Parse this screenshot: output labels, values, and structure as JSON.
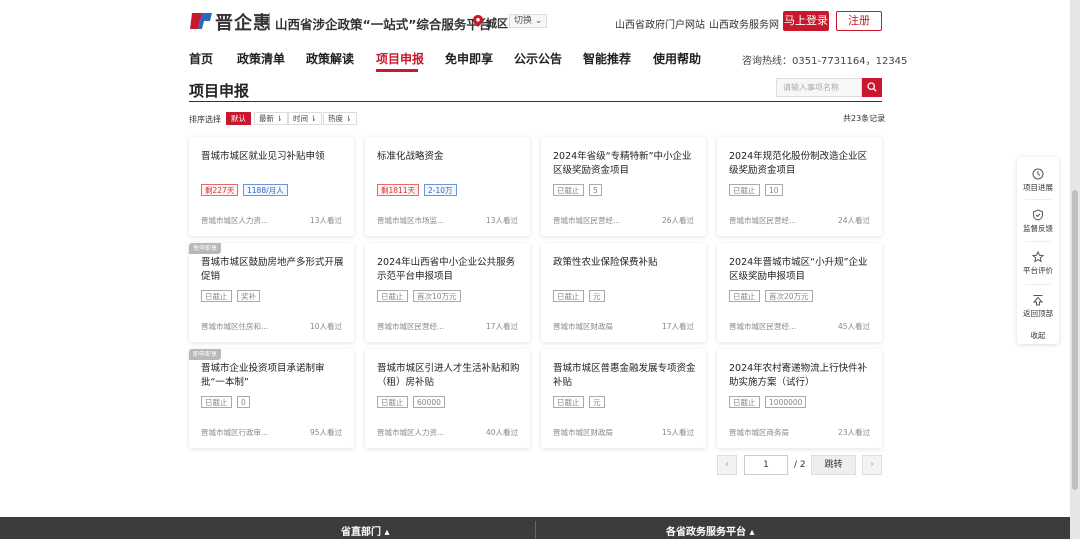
{
  "brand": {
    "logo_text": "晋企惠",
    "platform_name": "山西省涉企政策“一站式”综合服务平台",
    "location": "城区",
    "switch_label": "切换"
  },
  "top_links": [
    "山西省政府门户网站",
    "山西政务服务网"
  ],
  "auth": {
    "login": "马上登录",
    "register": "注册"
  },
  "nav": {
    "items": [
      "首页",
      "政策清单",
      "政策解读",
      "项目申报",
      "免申即享",
      "公示公告",
      "智能推荐",
      "使用帮助"
    ],
    "active": "项目申报",
    "hotline": "咨询热线：0351-7731164，12345"
  },
  "section": {
    "title": "项目申报",
    "search_placeholder": "请输入事项名称"
  },
  "sort": {
    "label": "排序选择",
    "options": [
      "默认",
      "最新 ⇂",
      "时间 ⇂",
      "热度 ⇂"
    ],
    "total": "共23条记录"
  },
  "cards": [
    {
      "name": "晋城市城区就业见习补贴申领",
      "tags": [
        {
          "t": "剩227天",
          "s": "red"
        },
        {
          "t": "1188/月人",
          "s": "blue"
        }
      ],
      "dept": "晋城市城区人力资...",
      "views": "13人看过",
      "corner": ""
    },
    {
      "name": "标准化战略资金",
      "tags": [
        {
          "t": "剩1811天",
          "s": "red"
        },
        {
          "t": "2-10万",
          "s": "blue"
        }
      ],
      "dept": "晋城市城区市场监...",
      "views": "13人看过",
      "corner": ""
    },
    {
      "name": "2024年省级“专精特新”中小企业区级奖励资金项目",
      "tags": [
        {
          "t": "已截止",
          "s": ""
        },
        {
          "t": "5",
          "s": ""
        }
      ],
      "dept": "晋城市城区民营经...",
      "views": "26人看过",
      "corner": ""
    },
    {
      "name": "2024年规范化股份制改造企业区级奖励资金项目",
      "tags": [
        {
          "t": "已截止",
          "s": ""
        },
        {
          "t": "10",
          "s": ""
        }
      ],
      "dept": "晋城市城区民营经...",
      "views": "24人看过",
      "corner": ""
    },
    {
      "name": "晋城市城区鼓励房地产多形式开展促销",
      "tags": [
        {
          "t": "已截止",
          "s": ""
        },
        {
          "t": "奖补",
          "s": ""
        }
      ],
      "dept": "晋城市城区住房和...",
      "views": "10人看过",
      "corner": "免申即享"
    },
    {
      "name": "2024年山西省中小企业公共服务示范平台申报项目",
      "tags": [
        {
          "t": "已截止",
          "s": ""
        },
        {
          "t": "首次10万元",
          "s": ""
        }
      ],
      "dept": "晋城市城区民营经...",
      "views": "17人看过",
      "corner": ""
    },
    {
      "name": "政策性农业保险保费补贴",
      "tags": [
        {
          "t": "已截止",
          "s": ""
        },
        {
          "t": "元",
          "s": ""
        }
      ],
      "dept": "晋城市城区财政局",
      "views": "17人看过",
      "corner": ""
    },
    {
      "name": "2024年晋城市城区“小升规”企业区级奖励申报项目",
      "tags": [
        {
          "t": "已截止",
          "s": ""
        },
        {
          "t": "首次20万元",
          "s": ""
        }
      ],
      "dept": "晋城市城区民营经...",
      "views": "45人看过",
      "corner": ""
    },
    {
      "name": "晋城市企业投资项目承诺制审批“一本制”",
      "tags": [
        {
          "t": "已截止",
          "s": ""
        },
        {
          "t": "0",
          "s": ""
        }
      ],
      "dept": "晋城市城区行政审...",
      "views": "95人看过",
      "corner": "即申即享"
    },
    {
      "name": "晋城市城区引进人才生活补贴和购（租）房补贴",
      "tags": [
        {
          "t": "已截止",
          "s": ""
        },
        {
          "t": "60000",
          "s": ""
        }
      ],
      "dept": "晋城市城区人力资...",
      "views": "40人看过",
      "corner": ""
    },
    {
      "name": "晋城市城区普惠金融发展专项资金补贴",
      "tags": [
        {
          "t": "已截止",
          "s": ""
        },
        {
          "t": "元",
          "s": ""
        }
      ],
      "dept": "晋城市城区财政局",
      "views": "15人看过",
      "corner": ""
    },
    {
      "name": "2024年农村寄递物流上行快件补助实施方案（试行）",
      "tags": [
        {
          "t": "已截止",
          "s": ""
        },
        {
          "t": "1000000",
          "s": ""
        }
      ],
      "dept": "晋城市城区商务局",
      "views": "23人看过",
      "corner": ""
    }
  ],
  "pagination": {
    "prev": "‹",
    "current": "1",
    "total": "/ 2",
    "go": "跳转",
    "next": "›"
  },
  "side_tools": [
    "项目进展",
    "监督反馈",
    "平台评价",
    "返回顶部",
    "收起"
  ],
  "footer": [
    "省直部门 ▴",
    "各省政务服务平台 ▴"
  ],
  "colors": {
    "brand_red": "#c8182d",
    "tag_blue": "#2f67c0"
  }
}
